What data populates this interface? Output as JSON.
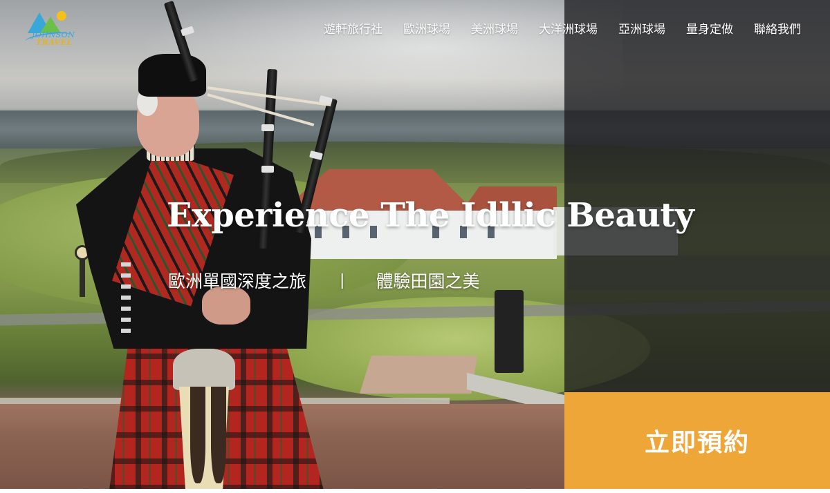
{
  "brand": {
    "logo_line1": "JOHNSON",
    "logo_line2": "TRAVEL"
  },
  "nav": {
    "items": [
      {
        "label": "遊軒旅行社"
      },
      {
        "label": "歐洲球場"
      },
      {
        "label": "美洲球場"
      },
      {
        "label": "大洋洲球場"
      },
      {
        "label": "亞洲球場"
      },
      {
        "label": "量身定做"
      },
      {
        "label": "聯絡我們"
      }
    ]
  },
  "hero": {
    "title": "Experience The Idllic Beauty",
    "subtitle_left": "歐洲單國深度之旅",
    "separator": "|",
    "subtitle_right": "體驗田園之美"
  },
  "cta": {
    "label": "立即預約"
  },
  "colors": {
    "cta_background": "#efa638",
    "overlay_panel": "#1e1e20",
    "logo_blue": "#3aa7dc",
    "logo_gold": "#e6b21c",
    "text": "#ffffff"
  }
}
